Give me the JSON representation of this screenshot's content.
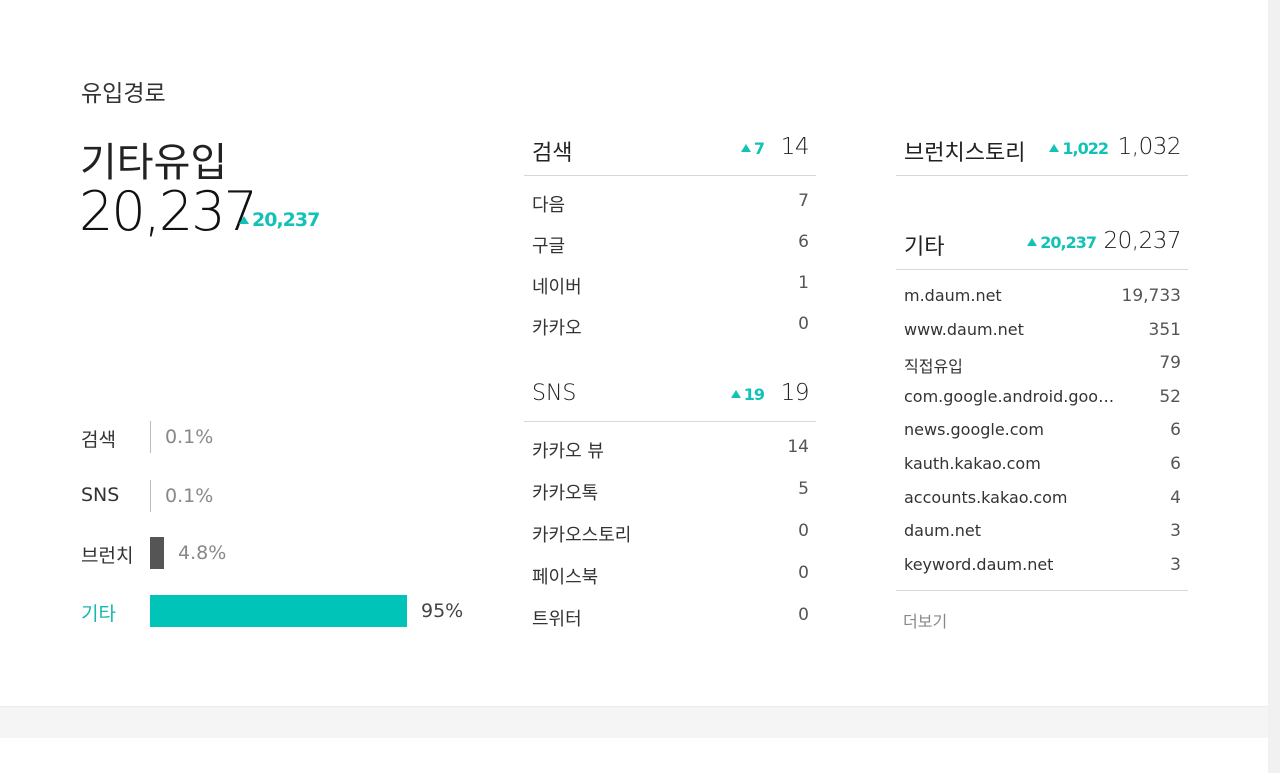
{
  "section_title": "유입경로",
  "main": {
    "name": "기타유입",
    "total": "20,237",
    "delta": "20,237"
  },
  "share": [
    {
      "label": "검색",
      "pct": "0.1%",
      "fraction": 0.001,
      "color": "#bbbbbb",
      "highlight": false
    },
    {
      "label": "SNS",
      "pct": "0.1%",
      "fraction": 0.001,
      "color": "#bbbbbb",
      "highlight": false
    },
    {
      "label": "브런치",
      "pct": "4.8%",
      "fraction": 0.048,
      "color": "#555555",
      "highlight": false
    },
    {
      "label": "기타",
      "pct": "95%",
      "fraction": 0.95,
      "color": "#00c4b8",
      "highlight": true
    }
  ],
  "search": {
    "title": "검색",
    "delta": "7",
    "total": "14",
    "items": [
      {
        "name": "다음",
        "value": "7"
      },
      {
        "name": "구글",
        "value": "6"
      },
      {
        "name": "네이버",
        "value": "1"
      },
      {
        "name": "카카오",
        "value": "0"
      }
    ]
  },
  "sns": {
    "title": "SNS",
    "delta": "19",
    "total": "19",
    "items": [
      {
        "name": "카카오 뷰",
        "value": "14"
      },
      {
        "name": "카카오톡",
        "value": "5"
      },
      {
        "name": "카카오스토리",
        "value": "0"
      },
      {
        "name": "페이스북",
        "value": "0"
      },
      {
        "name": "트위터",
        "value": "0"
      }
    ]
  },
  "brunch": {
    "title": "브런치스토리",
    "delta": "1,022",
    "total": "1,032"
  },
  "etc": {
    "title": "기타",
    "delta": "20,237",
    "total": "20,237",
    "items": [
      {
        "name": "m.daum.net",
        "value": "19,733"
      },
      {
        "name": "www.daum.net",
        "value": "351"
      },
      {
        "name": "직접유입",
        "value": "79"
      },
      {
        "name": "com.google.android.goo…",
        "value": "52"
      },
      {
        "name": "news.google.com",
        "value": "6"
      },
      {
        "name": "kauth.kakao.com",
        "value": "6"
      },
      {
        "name": "accounts.kakao.com",
        "value": "4"
      },
      {
        "name": "daum.net",
        "value": "3"
      },
      {
        "name": "keyword.daum.net",
        "value": "3"
      }
    ],
    "more_label": "더보기"
  },
  "colors": {
    "accent": "#13c2b6",
    "bar_main": "#00c4b8",
    "bar_dark": "#555555",
    "bar_thin": "#bbbbbb"
  }
}
